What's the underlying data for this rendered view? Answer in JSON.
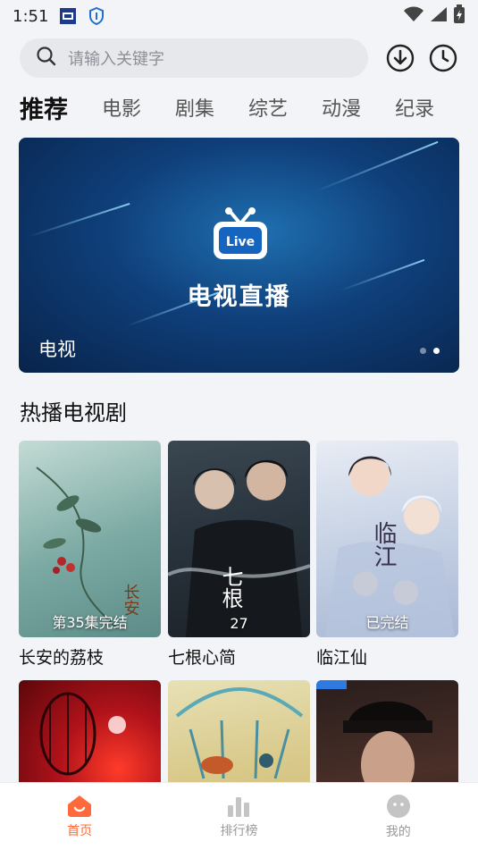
{
  "status_bar": {
    "time": "1:51"
  },
  "search": {
    "placeholder": "请输入关键字"
  },
  "tabs": [
    {
      "label": "推荐",
      "active": true
    },
    {
      "label": "电影"
    },
    {
      "label": "剧集"
    },
    {
      "label": "综艺"
    },
    {
      "label": "动漫"
    },
    {
      "label": "纪录"
    }
  ],
  "banner": {
    "logo_text": "Live",
    "title": "电视直播",
    "caption": "电视",
    "dot_count": 2,
    "active_dot": 2
  },
  "section": {
    "title": "热播电视剧",
    "items": [
      {
        "name": "长安的荔枝",
        "badge": "第35集完结"
      },
      {
        "name": "七根心简",
        "badge": "27"
      },
      {
        "name": "临江仙",
        "badge": "已完结"
      },
      {
        "name": "",
        "badge": ""
      },
      {
        "name": "",
        "badge": ""
      },
      {
        "name": "",
        "badge": ""
      }
    ]
  },
  "bottom_nav": [
    {
      "label": "首页",
      "icon": "home-icon",
      "active": true
    },
    {
      "label": "排行榜",
      "icon": "ranking-icon"
    },
    {
      "label": "我的",
      "icon": "profile-icon"
    }
  ],
  "colors": {
    "accent": "#ff6a3c",
    "background": "#f3f4f7"
  }
}
